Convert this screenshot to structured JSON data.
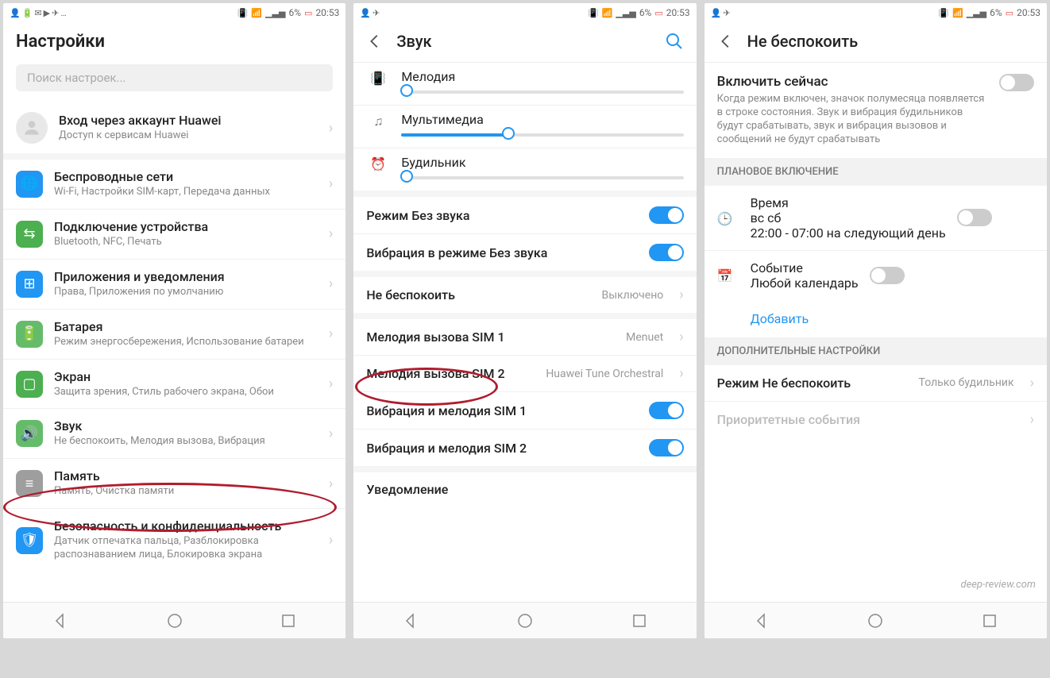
{
  "statusbar": {
    "battery": "6%",
    "time": "20:53"
  },
  "phone1": {
    "title": "Настройки",
    "search_placeholder": "Поиск настроек...",
    "account": {
      "title": "Вход через аккаунт Huawei",
      "subtitle": "Доступ к сервисам Huawei"
    },
    "items": [
      {
        "title": "Беспроводные сети",
        "subtitle": "Wi-Fi, Настройки SIM-карт, Передача данных"
      },
      {
        "title": "Подключение устройства",
        "subtitle": "Bluetooth, NFC, Печать"
      },
      {
        "title": "Приложения и уведомления",
        "subtitle": "Права, Приложения по умолчанию"
      },
      {
        "title": "Батарея",
        "subtitle": "Режим энергосбережения, Использование батареи"
      },
      {
        "title": "Экран",
        "subtitle": "Защита зрения, Стиль рабочего экрана, Обои"
      },
      {
        "title": "Звук",
        "subtitle": "Не беспокоить, Мелодия вызова, Вибрация"
      },
      {
        "title": "Память",
        "subtitle": "Память, Очистка памяти"
      },
      {
        "title": "Безопасность и конфиденциальность",
        "subtitle": "Датчик отпечатка пальца, Разблокировка распознаванием лица, Блокировка экрана"
      }
    ]
  },
  "phone2": {
    "title": "Звук",
    "sliders": [
      {
        "label": "Мелодия",
        "value": 2
      },
      {
        "label": "Мультимедиа",
        "value": 38
      },
      {
        "label": "Будильник",
        "value": 2
      }
    ],
    "toggles": [
      {
        "label": "Режим Без звука",
        "on": true
      },
      {
        "label": "Вибрация в режиме Без звука",
        "on": true
      }
    ],
    "dnd": {
      "label": "Не беспокоить",
      "value": "Выключено"
    },
    "ringtones": [
      {
        "label": "Мелодия вызова SIM 1",
        "value": "Menuet"
      },
      {
        "label": "Мелодия вызова SIM 2",
        "value": "Huawei Tune Orchestral"
      }
    ],
    "vibes": [
      {
        "label": "Вибрация и мелодия SIM 1",
        "on": true
      },
      {
        "label": "Вибрация и мелодия SIM 2",
        "on": true
      }
    ],
    "notif": {
      "label": "Уведомление"
    }
  },
  "phone3": {
    "title": "Не беспокоить",
    "enable": {
      "title": "Включить сейчас",
      "desc": "Когда режим включен, значок полумесяца появляется в строке состояния. Звук и вибрация будильников будут срабатывать, звук и вибрация вызовов и сообщений не будут срабатывать"
    },
    "sect1": "ПЛАНОВОЕ ВКЛЮЧЕНИЕ",
    "time_item": {
      "title": "Время",
      "days": "вс сб",
      "range": "22:00 - 07:00 на следующий день"
    },
    "event_item": {
      "title": "Событие",
      "sub": "Любой календарь"
    },
    "add": "Добавить",
    "sect2": "ДОПОЛНИТЕЛЬНЫЕ НАСТРОЙКИ",
    "mode": {
      "label": "Режим Не беспокоить",
      "value": "Только будильник"
    },
    "priority": "Приоритетные события"
  },
  "watermark": "deep-review.com"
}
